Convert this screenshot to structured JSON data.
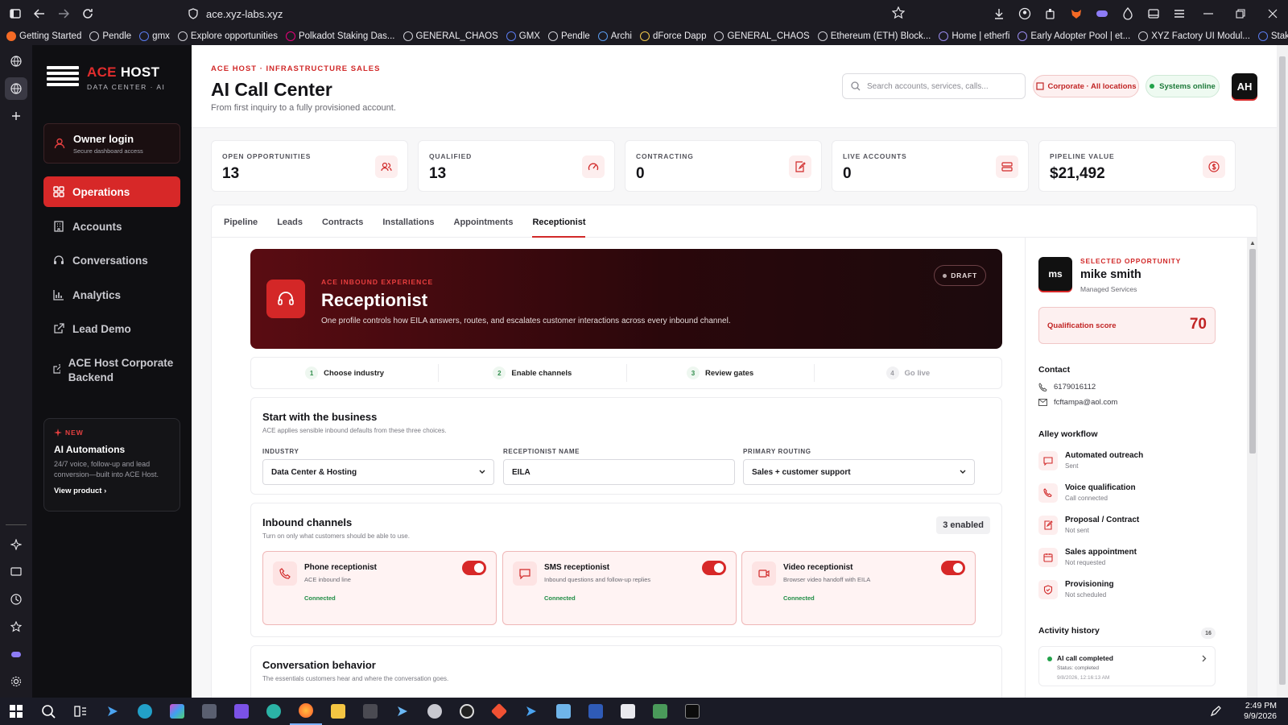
{
  "browser": {
    "url": "ace.xyz-labs.xyz",
    "bookmarks": [
      "Getting Started",
      "Pendle",
      "gmx",
      "Explore opportunities",
      "Polkadot Staking Das...",
      "GENERAL_CHAOS",
      "GMX",
      "Pendle",
      "Archi",
      "dForce Dapp",
      "GENERAL_CHAOS",
      "Ethereum (ETH) Block...",
      "Home | etherfi",
      "Early Adopter Pool | et...",
      "XYZ Factory UI Modul...",
      "Stake | ether.fan"
    ]
  },
  "sidebar": {
    "logo_brand_accent": "ACE",
    "logo_brand": "HOST",
    "logo_tagline": "DATA CENTER · AI",
    "owner_title": "Owner login",
    "owner_sub": "Secure dashboard access",
    "nav": [
      {
        "label": "Operations",
        "icon": "grid-icon"
      },
      {
        "label": "Accounts",
        "icon": "building-icon"
      },
      {
        "label": "Conversations",
        "icon": "headset-icon"
      },
      {
        "label": "Analytics",
        "icon": "bar-chart-icon"
      },
      {
        "label": "Lead Demo",
        "icon": "external-link-icon"
      },
      {
        "label": "ACE Host Corporate Backend",
        "icon": "external-link-icon"
      }
    ],
    "promo": {
      "badge": "NEW",
      "title": "AI Automations",
      "desc": "24/7 voice, follow-up and lead conversion—built into ACE Host.",
      "link": "View product"
    }
  },
  "header": {
    "eyebrow": "ACE HOST · INFRASTRUCTURE SALES",
    "title": "AI Call Center",
    "subtitle": "From first inquiry to a fully provisioned account.",
    "search_placeholder": "Search accounts, services, calls...",
    "location": "Corporate · All locations",
    "status": "Systems online",
    "avatar": "AH"
  },
  "stats": [
    {
      "label": "OPEN OPPORTUNITIES",
      "value": "13",
      "icon": "users-icon"
    },
    {
      "label": "QUALIFIED",
      "value": "13",
      "icon": "gauge-icon"
    },
    {
      "label": "CONTRACTING",
      "value": "0",
      "icon": "document-edit-icon"
    },
    {
      "label": "LIVE ACCOUNTS",
      "value": "0",
      "icon": "server-icon"
    },
    {
      "label": "PIPELINE VALUE",
      "value": "$21,492",
      "icon": "dollar-icon"
    }
  ],
  "tabs": [
    "Pipeline",
    "Leads",
    "Contracts",
    "Installations",
    "Appointments",
    "Receptionist"
  ],
  "active_tab": "Receptionist",
  "hero": {
    "eyebrow": "ACE INBOUND EXPERIENCE",
    "title": "Receptionist",
    "desc": "One profile controls how EILA answers, routes, and escalates customer interactions across every inbound channel.",
    "status": "DRAFT"
  },
  "steps": [
    {
      "num": "1",
      "label": "Choose industry"
    },
    {
      "num": "2",
      "label": "Enable channels"
    },
    {
      "num": "3",
      "label": "Review gates"
    },
    {
      "num": "4",
      "label": "Go live"
    }
  ],
  "business": {
    "title": "Start with the business",
    "desc": "ACE applies sensible inbound defaults from these three choices.",
    "industry_label": "INDUSTRY",
    "industry_value": "Data Center & Hosting",
    "name_label": "RECEPTIONIST NAME",
    "name_value": "EILA",
    "routing_label": "PRIMARY ROUTING",
    "routing_value": "Sales + customer support"
  },
  "channels": {
    "title": "Inbound channels",
    "desc": "Turn on only what customers should be able to use.",
    "count": "3 enabled",
    "items": [
      {
        "name": "Phone receptionist",
        "desc": "ACE inbound line",
        "status": "Connected",
        "enabled": true
      },
      {
        "name": "SMS receptionist",
        "desc": "Inbound questions and follow-up replies",
        "status": "Connected",
        "enabled": true
      },
      {
        "name": "Video receptionist",
        "desc": "Browser video handoff with EILA",
        "status": "Connected",
        "enabled": true
      }
    ]
  },
  "behavior": {
    "title": "Conversation behavior",
    "desc": "The essentials customers hear and where the conversation goes."
  },
  "detail": {
    "initials": "ms",
    "eyebrow": "SELECTED OPPORTUNITY",
    "name": "mike smith",
    "service": "Managed Services",
    "score_label": "Qualification score",
    "score": "70",
    "contact_title": "Contact",
    "phone": "6179016112",
    "email": "fcftampa@aol.com",
    "workflow_title": "Alley workflow",
    "workflow": [
      {
        "title": "Automated outreach",
        "status": "Sent",
        "icon": "message-icon"
      },
      {
        "title": "Voice qualification",
        "status": "Call connected",
        "icon": "phone-icon"
      },
      {
        "title": "Proposal / Contract",
        "status": "Not sent",
        "icon": "document-edit-icon"
      },
      {
        "title": "Sales appointment",
        "status": "Not requested",
        "icon": "calendar-icon"
      },
      {
        "title": "Provisioning",
        "status": "Not scheduled",
        "icon": "shield-icon"
      }
    ],
    "history_title": "Activity history",
    "history_count": "16",
    "activity": {
      "title": "AI call completed",
      "status": "Status: completed",
      "date": "9/8/2026, 12:16:13 AM"
    }
  },
  "taskbar": {
    "time": "2:49 PM",
    "date": "9/9/2026"
  },
  "colors": {
    "accent": "#d72828",
    "success": "#22a24a",
    "sidebar": "#0f0f12"
  }
}
